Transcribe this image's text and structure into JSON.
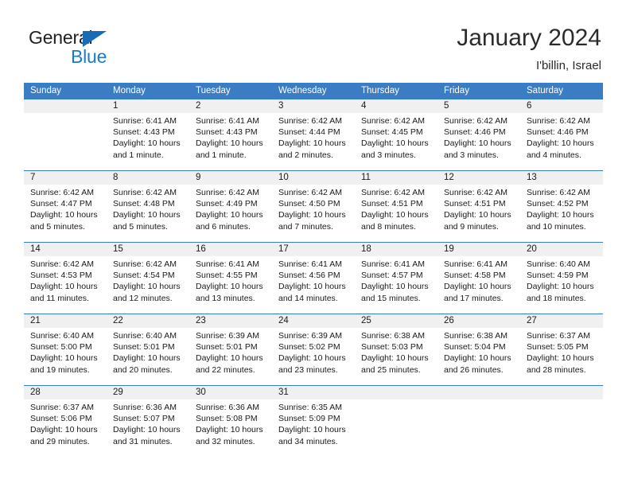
{
  "logo": {
    "word_top": "General",
    "word_bottom": "Blue",
    "triangle_color": "#1a6bb5",
    "blue_color": "#1a7ad1"
  },
  "header": {
    "title": "January 2024",
    "subtitle": "I'billin, Israel"
  },
  "theme": {
    "header_blue": "#3b7dc4",
    "daynum_band": "#f0f0f0",
    "text": "#1a1a1a"
  },
  "calendar": {
    "weekdays": [
      "Sunday",
      "Monday",
      "Tuesday",
      "Wednesday",
      "Thursday",
      "Friday",
      "Saturday"
    ],
    "weeks": [
      [
        {
          "day": "",
          "sunrise": "",
          "sunset": "",
          "daylight": ""
        },
        {
          "day": "1",
          "sunrise": "Sunrise: 6:41 AM",
          "sunset": "Sunset: 4:43 PM",
          "daylight": "Daylight: 10 hours and 1 minute."
        },
        {
          "day": "2",
          "sunrise": "Sunrise: 6:41 AM",
          "sunset": "Sunset: 4:43 PM",
          "daylight": "Daylight: 10 hours and 1 minute."
        },
        {
          "day": "3",
          "sunrise": "Sunrise: 6:42 AM",
          "sunset": "Sunset: 4:44 PM",
          "daylight": "Daylight: 10 hours and 2 minutes."
        },
        {
          "day": "4",
          "sunrise": "Sunrise: 6:42 AM",
          "sunset": "Sunset: 4:45 PM",
          "daylight": "Daylight: 10 hours and 3 minutes."
        },
        {
          "day": "5",
          "sunrise": "Sunrise: 6:42 AM",
          "sunset": "Sunset: 4:46 PM",
          "daylight": "Daylight: 10 hours and 3 minutes."
        },
        {
          "day": "6",
          "sunrise": "Sunrise: 6:42 AM",
          "sunset": "Sunset: 4:46 PM",
          "daylight": "Daylight: 10 hours and 4 minutes."
        }
      ],
      [
        {
          "day": "7",
          "sunrise": "Sunrise: 6:42 AM",
          "sunset": "Sunset: 4:47 PM",
          "daylight": "Daylight: 10 hours and 5 minutes."
        },
        {
          "day": "8",
          "sunrise": "Sunrise: 6:42 AM",
          "sunset": "Sunset: 4:48 PM",
          "daylight": "Daylight: 10 hours and 5 minutes."
        },
        {
          "day": "9",
          "sunrise": "Sunrise: 6:42 AM",
          "sunset": "Sunset: 4:49 PM",
          "daylight": "Daylight: 10 hours and 6 minutes."
        },
        {
          "day": "10",
          "sunrise": "Sunrise: 6:42 AM",
          "sunset": "Sunset: 4:50 PM",
          "daylight": "Daylight: 10 hours and 7 minutes."
        },
        {
          "day": "11",
          "sunrise": "Sunrise: 6:42 AM",
          "sunset": "Sunset: 4:51 PM",
          "daylight": "Daylight: 10 hours and 8 minutes."
        },
        {
          "day": "12",
          "sunrise": "Sunrise: 6:42 AM",
          "sunset": "Sunset: 4:51 PM",
          "daylight": "Daylight: 10 hours and 9 minutes."
        },
        {
          "day": "13",
          "sunrise": "Sunrise: 6:42 AM",
          "sunset": "Sunset: 4:52 PM",
          "daylight": "Daylight: 10 hours and 10 minutes."
        }
      ],
      [
        {
          "day": "14",
          "sunrise": "Sunrise: 6:42 AM",
          "sunset": "Sunset: 4:53 PM",
          "daylight": "Daylight: 10 hours and 11 minutes."
        },
        {
          "day": "15",
          "sunrise": "Sunrise: 6:42 AM",
          "sunset": "Sunset: 4:54 PM",
          "daylight": "Daylight: 10 hours and 12 minutes."
        },
        {
          "day": "16",
          "sunrise": "Sunrise: 6:41 AM",
          "sunset": "Sunset: 4:55 PM",
          "daylight": "Daylight: 10 hours and 13 minutes."
        },
        {
          "day": "17",
          "sunrise": "Sunrise: 6:41 AM",
          "sunset": "Sunset: 4:56 PM",
          "daylight": "Daylight: 10 hours and 14 minutes."
        },
        {
          "day": "18",
          "sunrise": "Sunrise: 6:41 AM",
          "sunset": "Sunset: 4:57 PM",
          "daylight": "Daylight: 10 hours and 15 minutes."
        },
        {
          "day": "19",
          "sunrise": "Sunrise: 6:41 AM",
          "sunset": "Sunset: 4:58 PM",
          "daylight": "Daylight: 10 hours and 17 minutes."
        },
        {
          "day": "20",
          "sunrise": "Sunrise: 6:40 AM",
          "sunset": "Sunset: 4:59 PM",
          "daylight": "Daylight: 10 hours and 18 minutes."
        }
      ],
      [
        {
          "day": "21",
          "sunrise": "Sunrise: 6:40 AM",
          "sunset": "Sunset: 5:00 PM",
          "daylight": "Daylight: 10 hours and 19 minutes."
        },
        {
          "day": "22",
          "sunrise": "Sunrise: 6:40 AM",
          "sunset": "Sunset: 5:01 PM",
          "daylight": "Daylight: 10 hours and 20 minutes."
        },
        {
          "day": "23",
          "sunrise": "Sunrise: 6:39 AM",
          "sunset": "Sunset: 5:01 PM",
          "daylight": "Daylight: 10 hours and 22 minutes."
        },
        {
          "day": "24",
          "sunrise": "Sunrise: 6:39 AM",
          "sunset": "Sunset: 5:02 PM",
          "daylight": "Daylight: 10 hours and 23 minutes."
        },
        {
          "day": "25",
          "sunrise": "Sunrise: 6:38 AM",
          "sunset": "Sunset: 5:03 PM",
          "daylight": "Daylight: 10 hours and 25 minutes."
        },
        {
          "day": "26",
          "sunrise": "Sunrise: 6:38 AM",
          "sunset": "Sunset: 5:04 PM",
          "daylight": "Daylight: 10 hours and 26 minutes."
        },
        {
          "day": "27",
          "sunrise": "Sunrise: 6:37 AM",
          "sunset": "Sunset: 5:05 PM",
          "daylight": "Daylight: 10 hours and 28 minutes."
        }
      ],
      [
        {
          "day": "28",
          "sunrise": "Sunrise: 6:37 AM",
          "sunset": "Sunset: 5:06 PM",
          "daylight": "Daylight: 10 hours and 29 minutes."
        },
        {
          "day": "29",
          "sunrise": "Sunrise: 6:36 AM",
          "sunset": "Sunset: 5:07 PM",
          "daylight": "Daylight: 10 hours and 31 minutes."
        },
        {
          "day": "30",
          "sunrise": "Sunrise: 6:36 AM",
          "sunset": "Sunset: 5:08 PM",
          "daylight": "Daylight: 10 hours and 32 minutes."
        },
        {
          "day": "31",
          "sunrise": "Sunrise: 6:35 AM",
          "sunset": "Sunset: 5:09 PM",
          "daylight": "Daylight: 10 hours and 34 minutes."
        },
        {
          "day": "",
          "sunrise": "",
          "sunset": "",
          "daylight": ""
        },
        {
          "day": "",
          "sunrise": "",
          "sunset": "",
          "daylight": ""
        },
        {
          "day": "",
          "sunrise": "",
          "sunset": "",
          "daylight": ""
        }
      ]
    ]
  }
}
